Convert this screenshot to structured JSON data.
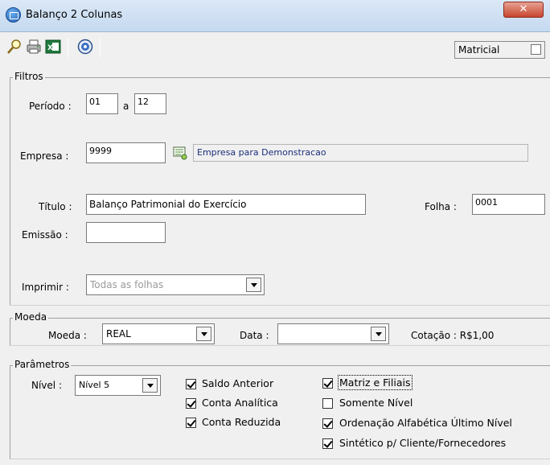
{
  "window": {
    "title": "Balanço 2 Colunas",
    "close_glyph": "✕"
  },
  "toolbar": {
    "icons": [
      "search-icon",
      "print-icon",
      "excel-icon",
      "help-icon"
    ],
    "matricial_label": "Matricial",
    "matricial_checked": false
  },
  "filtros": {
    "legend": "Filtros",
    "periodo_label": "Período :",
    "periodo_from": "01",
    "periodo_sep": "a",
    "periodo_to": "12",
    "empresa_label": "Empresa :",
    "empresa_value": "9999",
    "empresa_desc": "Empresa para Demonstracao",
    "titulo_label": "Título :",
    "titulo_value": "Balanço Patrimonial do Exercício",
    "folha_label": "Folha :",
    "folha_value": "0001",
    "emissao_label": "Emissão :",
    "emissao_value": "",
    "imprimir_label": "Imprimir :",
    "imprimir_value": "Todas as folhas"
  },
  "moeda": {
    "legend": "Moeda",
    "moeda_label": "Moeda :",
    "moeda_value": "REAL",
    "data_label": "Data :",
    "data_value": "",
    "cotacao_label": "Cotação : R$1,00"
  },
  "parametros": {
    "legend": "Parâmetros",
    "nivel_label": "Nível :",
    "nivel_value": "Nível 5",
    "checks": [
      {
        "label": "Saldo Anterior",
        "checked": true
      },
      {
        "label": "Conta Analítica",
        "checked": true
      },
      {
        "label": "Conta Reduzida",
        "checked": true
      },
      {
        "label": "Matriz e Filiais",
        "checked": true
      },
      {
        "label": "Somente Nível",
        "checked": false
      },
      {
        "label": "Ordenação Alfabética Último Nível",
        "checked": true
      },
      {
        "label": "Sintético p/ Cliente/Fornecedores",
        "checked": true
      }
    ]
  }
}
